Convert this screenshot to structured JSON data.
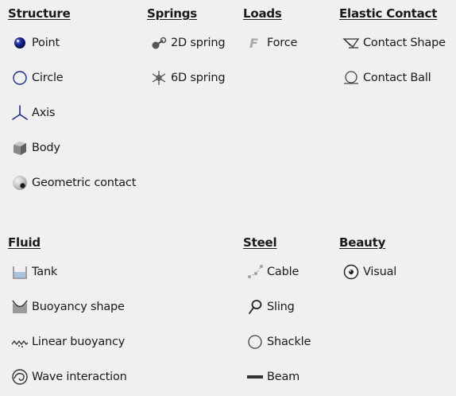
{
  "structure": {
    "header": "Structure",
    "items": [
      "Point",
      "Circle",
      "Axis",
      "Body",
      "Geometric contact"
    ]
  },
  "springs": {
    "header": "Springs",
    "items": [
      "2D spring",
      "6D spring"
    ]
  },
  "loads": {
    "header": "Loads",
    "items": [
      "Force"
    ]
  },
  "elastic_contact": {
    "header": "Elastic Contact",
    "items": [
      "Contact Shape",
      "Contact Ball"
    ]
  },
  "fluid": {
    "header": "Fluid",
    "items": [
      "Tank",
      "Buoyancy shape",
      "Linear buoyancy",
      "Wave interaction"
    ]
  },
  "steel": {
    "header": "Steel",
    "items": [
      "Cable",
      "Sling",
      "Shackle",
      "Beam"
    ]
  },
  "beauty": {
    "header": "Beauty",
    "items": [
      "Visual"
    ]
  },
  "colors": {
    "background": "#f0f0f0",
    "axis_icon": "#1c2b8c",
    "point_icon": "#0a1a70"
  }
}
